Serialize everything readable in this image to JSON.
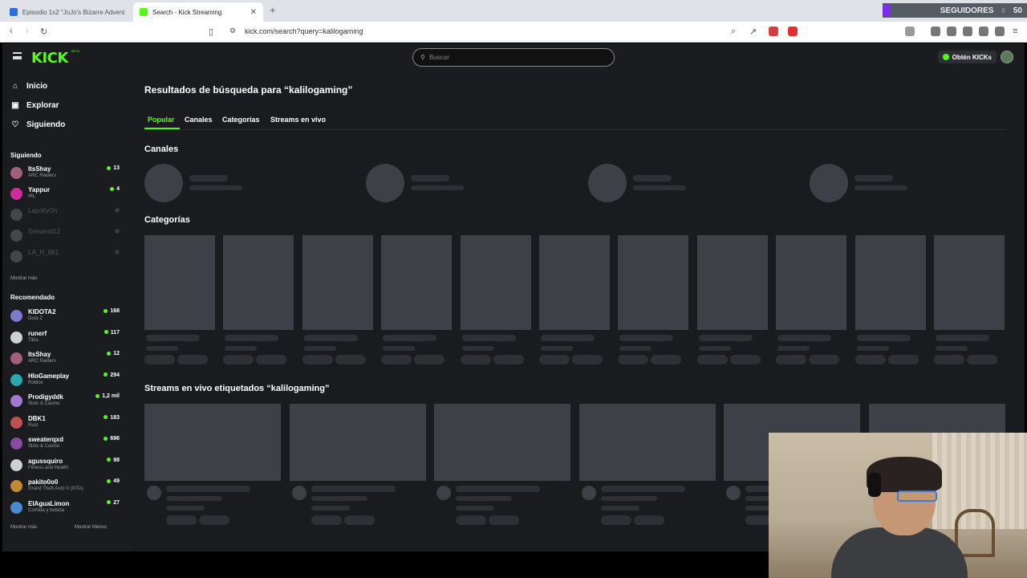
{
  "browser": {
    "tabs": [
      {
        "title": "Episodio 1x2 \"JoJo's Bizarre Advent",
        "active": false
      },
      {
        "title": "Search - Kick Streaming",
        "active": true
      }
    ],
    "url": "kick.com/search?query=kalilogaming"
  },
  "overlay": {
    "followers_label": "SEGUIDORES",
    "followers_count": "50",
    "small_count": "0"
  },
  "header": {
    "logo": "KICK",
    "logo_badge": "BETA",
    "search_placeholder": "Buscar",
    "kicks_button": "Obtén KICKs"
  },
  "sidebar": {
    "nav": [
      {
        "label": "Inicio",
        "icon": "home-icon"
      },
      {
        "label": "Explorar",
        "icon": "explore-icon"
      },
      {
        "label": "Siguiendo",
        "icon": "heart-icon"
      }
    ],
    "following_title": "Siguiendo",
    "following": [
      {
        "name": "ItsShay",
        "category": "ARC Raiders",
        "viewers": "13",
        "online": true,
        "color": "#a0607a"
      },
      {
        "name": "Yappur",
        "category": "IRL",
        "viewers": "4",
        "online": true,
        "color": "#d02a9e"
      },
      {
        "name": "LapoltyOn",
        "category": "",
        "viewers": "",
        "online": false,
        "color": "#888888"
      },
      {
        "name": "Genarod12",
        "category": "",
        "viewers": "",
        "online": false,
        "color": "#888888"
      },
      {
        "name": "LA_H_681",
        "category": "",
        "viewers": "",
        "online": false,
        "color": "#888888"
      }
    ],
    "show_more": "Mostrar más",
    "recommended_title": "Recomendado",
    "recommended": [
      {
        "name": "KIDOTA2",
        "category": "Dota 2",
        "viewers": "168",
        "color": "#7a7ad0"
      },
      {
        "name": "runerf",
        "category": "Tibia",
        "viewers": "117",
        "color": "#d0d0d0"
      },
      {
        "name": "ItsShay",
        "category": "ARC Raiders",
        "viewers": "12",
        "color": "#a0607a"
      },
      {
        "name": "HloGameplay",
        "category": "Roblox",
        "viewers": "294",
        "color": "#2aa8b0"
      },
      {
        "name": "Prodigyddk",
        "category": "Slots & Casino",
        "viewers": "1,2 mil",
        "color": "#a07ad0"
      },
      {
        "name": "DBK1",
        "category": "Rust",
        "viewers": "183",
        "color": "#c05050"
      },
      {
        "name": "sweaterqxd",
        "category": "Slots & Casino",
        "viewers": "696",
        "color": "#8a4aa0"
      },
      {
        "name": "agussquiro",
        "category": "Fitness and Health",
        "viewers": "98",
        "color": "#d0d0d0"
      },
      {
        "name": "pakito0o0",
        "category": "Grand Theft Auto V (GTA)",
        "viewers": "49",
        "color": "#c08a30"
      },
      {
        "name": "ElAguaLimon",
        "category": "Comida y bebida",
        "viewers": "27",
        "color": "#4a8ad0"
      }
    ],
    "show_more_2": "Mostrar más",
    "show_less": "Mostrar Menos"
  },
  "main": {
    "title": "Resultados de búsqueda para “kalilogaming”",
    "tabs": [
      "Popular",
      "Canales",
      "Categorías",
      "Streams en vivo"
    ],
    "channels_title": "Canales",
    "categories_title": "Categorías",
    "streams_title": "Streams en vivo etiquetados “kalilogaming”"
  }
}
